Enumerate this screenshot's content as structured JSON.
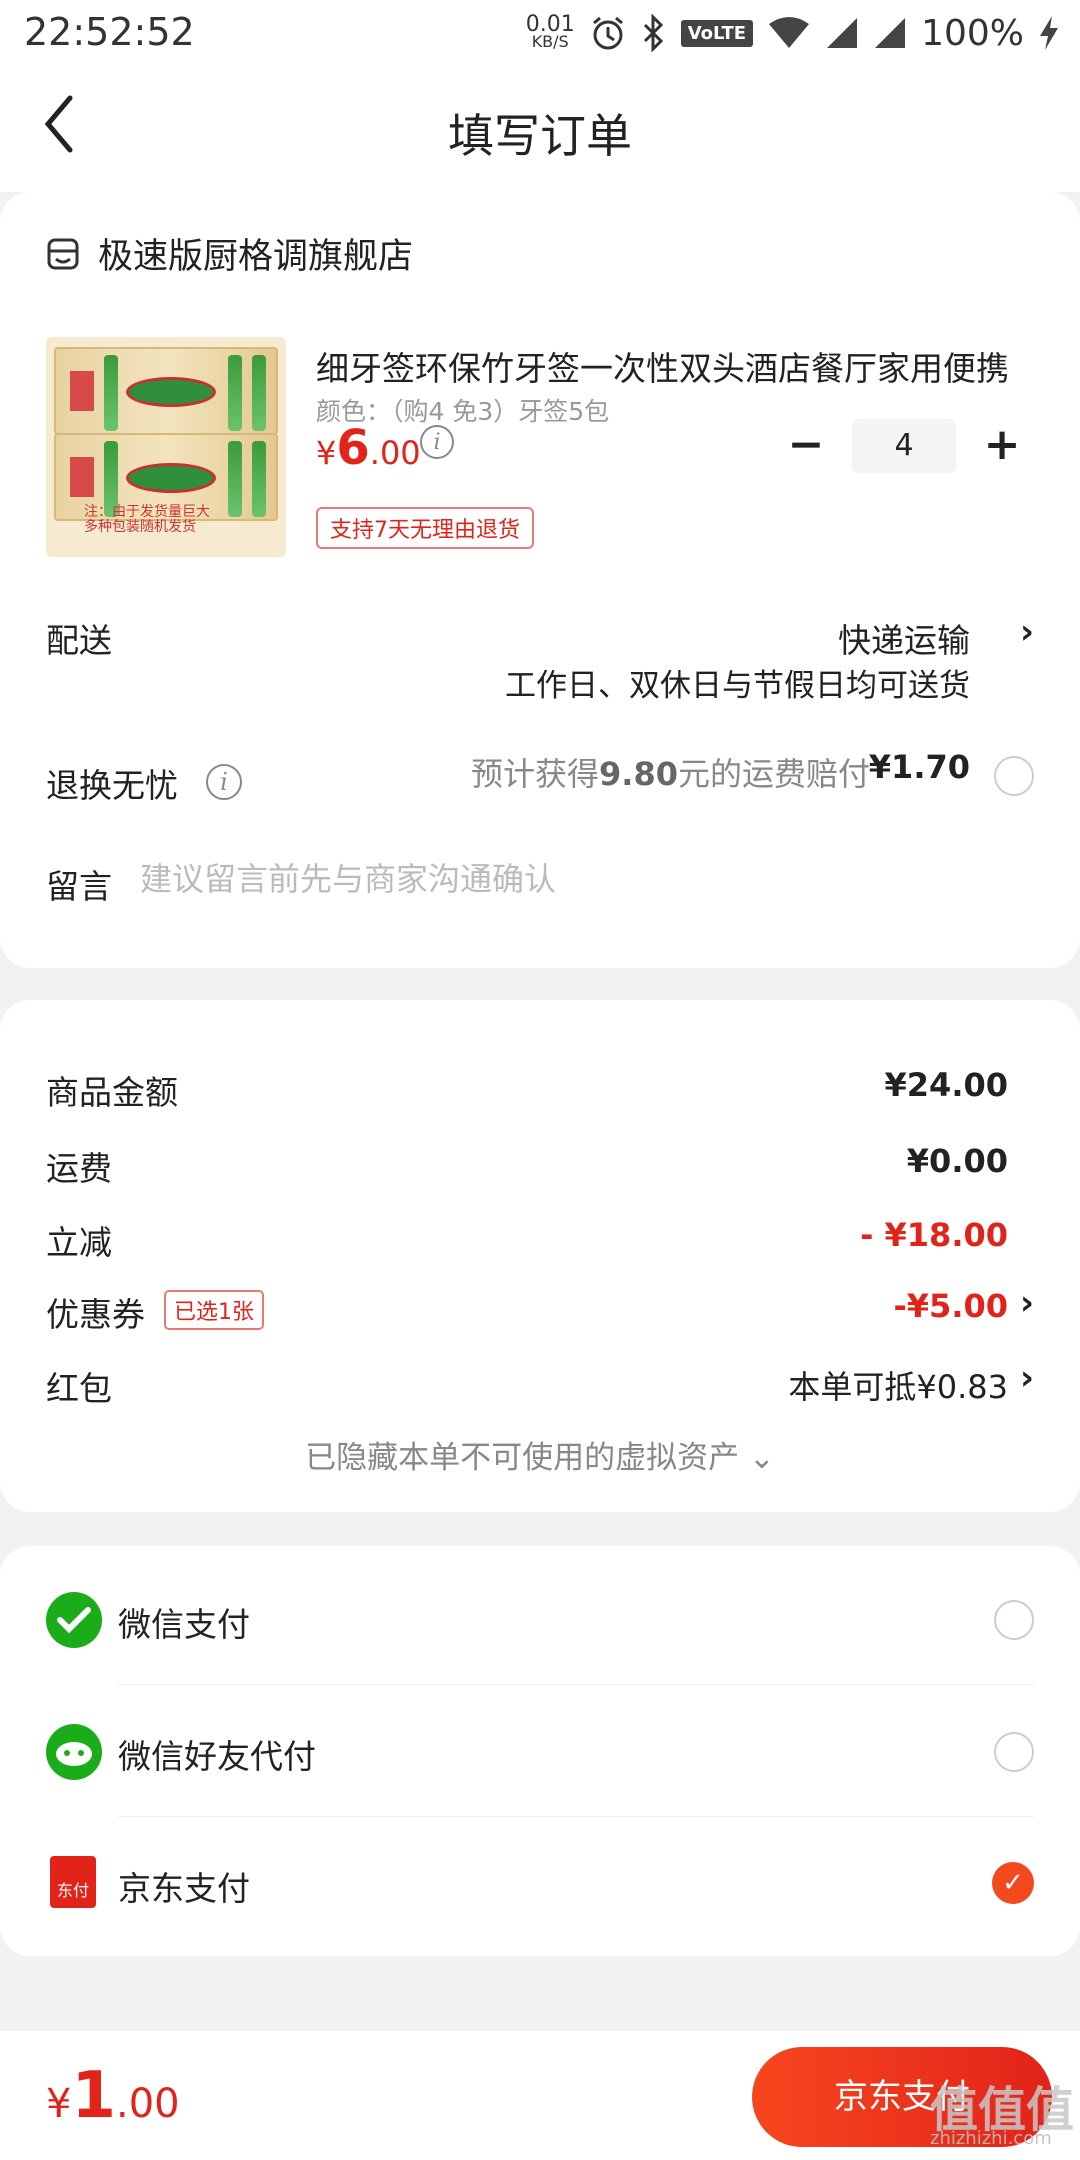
{
  "status_bar": {
    "time": "22:52:52",
    "speed_value": "0.01",
    "speed_unit": "KB/S",
    "network_badge": "VoLTE",
    "battery": "100%"
  },
  "header": {
    "title": "填写订单",
    "back_icon": "chevron-left-icon"
  },
  "store": {
    "name": "极速版厨格调旗舰店",
    "icon": "store-icon"
  },
  "product": {
    "title": "细牙签环保竹牙签一次性双头酒店餐厅家用便携",
    "spec": "颜色：（购4 免3）牙签5包",
    "price_currency": "¥",
    "price_int": "6",
    "price_dec": ".00",
    "quantity": "4",
    "minus": "−",
    "plus": "+",
    "return_badge": "支持7天无理由退货",
    "image_note_1": "注：由于发货量巨大",
    "image_note_2": "多种包装随机发货"
  },
  "shipping": {
    "label": "配送",
    "method": "快递运输",
    "desc": "工作日、双休日与节假日均可送货",
    "chevron": "›"
  },
  "return_free": {
    "label": "退换无忧",
    "text_prefix": "预计获得",
    "amount": "9.80",
    "text_suffix": "元的运费赔付",
    "price": "¥1.70"
  },
  "message": {
    "label": "留言",
    "placeholder": "建议留言前先与商家沟通确认"
  },
  "summary": {
    "goods_label": "商品金额",
    "goods_value": "¥24.00",
    "freight_label": "运费",
    "freight_value": "¥0.00",
    "discount_label": "立减",
    "discount_value": "- ¥18.00",
    "coupon_label": "优惠券",
    "coupon_badge": "已选1张",
    "coupon_value": "-¥5.00",
    "redpacket_label": "红包",
    "redpacket_value": "本单可抵¥0.83",
    "hidden_assets": "已隐藏本单不可使用的虚拟资产 ⌄"
  },
  "payment": {
    "methods": [
      {
        "name": "微信支付",
        "icon": "wechat-pay-icon",
        "selected": false
      },
      {
        "name": "微信好友代付",
        "icon": "wechat-friend-pay-icon",
        "selected": false
      },
      {
        "name": "京东支付",
        "icon": "jd-pay-icon",
        "selected": true,
        "icon_text": "东付"
      }
    ]
  },
  "bottom": {
    "total_currency": "¥",
    "total_int": "1",
    "total_dec": ".00",
    "pay_button": "京东支付"
  },
  "watermark": {
    "text": "值值值",
    "sub": "zhizhizhi.com"
  },
  "colors": {
    "accent_red": "#e2231a",
    "pay_orange": "#f24a1e",
    "wechat_green": "#1aad19"
  }
}
